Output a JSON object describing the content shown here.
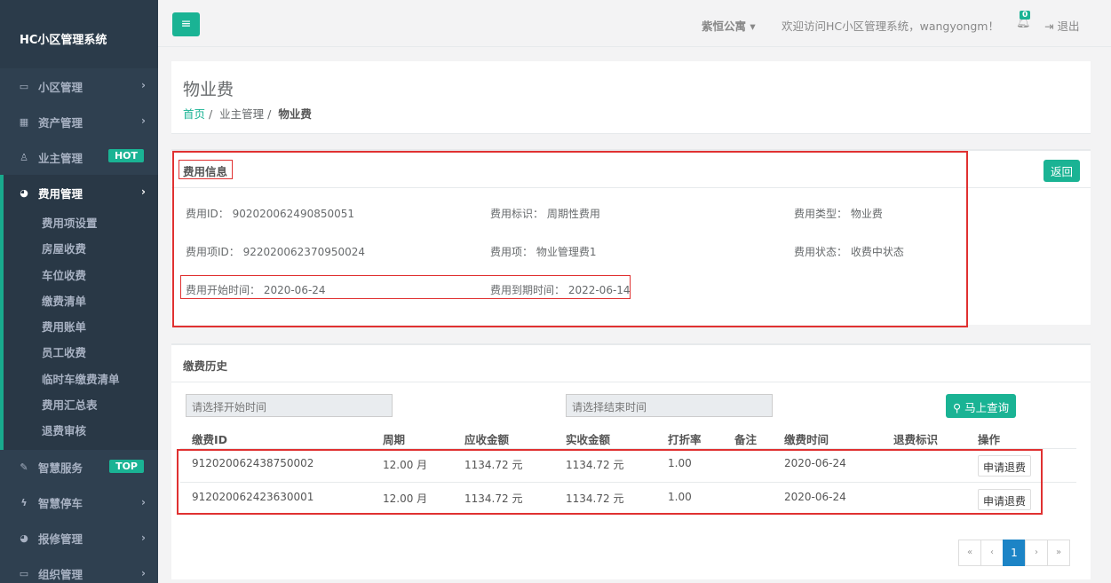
{
  "sidebar": {
    "brand": "HC小区管理系统",
    "items_top": [
      {
        "label": "小区管理",
        "icon": "▭"
      },
      {
        "label": "资产管理",
        "icon": "▦"
      },
      {
        "label": "业主管理",
        "icon": "♙",
        "badge": "HOT"
      }
    ],
    "active": {
      "label": "费用管理",
      "icon": "◕"
    },
    "sub_items": [
      "费用项设置",
      "房屋收费",
      "车位收费",
      "缴费清单",
      "费用账单",
      "员工收费",
      "临时车缴费清单",
      "费用汇总表",
      "退费审核"
    ],
    "items_bottom": [
      {
        "label": "智慧服务",
        "icon": "✎",
        "badge": "TOP"
      },
      {
        "label": "智慧停车",
        "icon": "ϟ"
      },
      {
        "label": "报修管理",
        "icon": "◕"
      },
      {
        "label": "组织管理",
        "icon": "▭"
      }
    ]
  },
  "topbar": {
    "property": "紫恒公寓",
    "welcome": "欢迎访问HC小区管理系统，wangyongm！",
    "notification_count": "0",
    "logout": "退出"
  },
  "page": {
    "title": "物业费",
    "breadcrumb": {
      "home": "首页",
      "sep": "/",
      "level2": "业主管理",
      "current": "物业费"
    }
  },
  "fee_info": {
    "title": "费用信息",
    "back": "返回",
    "fee_id": "费用ID： 902020062490850051",
    "fee_flag": "费用标识： 周期性费用",
    "fee_type": "费用类型： 物业费",
    "fee_item_id": "费用项ID： 922020062370950024",
    "fee_item": "费用项： 物业管理费1",
    "fee_status": "费用状态： 收费中状态",
    "start_time": "费用开始时间： 2020-06-24",
    "end_time": "费用到期时间： 2022-06-14"
  },
  "history": {
    "title": "缴费历史",
    "start_placeholder": "请选择开始时间",
    "end_placeholder": "请选择结束时间",
    "query": "马上查询",
    "columns": [
      "缴费ID",
      "周期",
      "应收金额",
      "实收金额",
      "打折率",
      "备注",
      "缴费时间",
      "退费标识",
      "操作"
    ],
    "rows": [
      {
        "id": "912020062438750002",
        "cycle": "12.00 月",
        "receivable": "1134.72 元",
        "received": "1134.72 元",
        "discount": "1.00",
        "remark": "",
        "time": "2020-06-24",
        "refund_flag": "",
        "action": "申请退费"
      },
      {
        "id": "912020062423630001",
        "cycle": "12.00 月",
        "receivable": "1134.72 元",
        "received": "1134.72 元",
        "discount": "1.00",
        "remark": "",
        "time": "2020-06-24",
        "refund_flag": "",
        "action": "申请退费"
      }
    ],
    "pagination": {
      "first": "«",
      "prev": "‹",
      "current": "1",
      "next": "›",
      "last": "»"
    }
  },
  "colors": {
    "accent": "#1ab394",
    "sidebar": "#2f4050",
    "highlight": "#e03131",
    "page_active": "#1c84c6"
  }
}
